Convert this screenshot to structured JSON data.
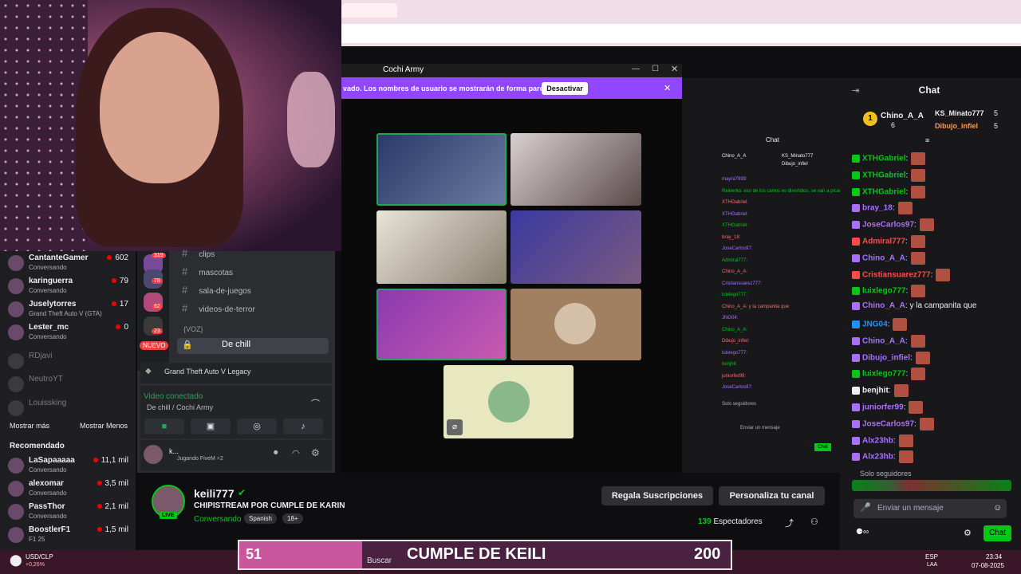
{
  "sidebar": {
    "followed": [
      {
        "name": "CantanteGamer",
        "status": "Conversando",
        "viewers": "602",
        "live": true
      },
      {
        "name": "karinguerra",
        "status": "Conversando",
        "viewers": "79",
        "live": true
      },
      {
        "name": "Juselytorres",
        "status": "Grand Theft Auto V (GTA)",
        "viewers": "17",
        "live": true
      },
      {
        "name": "Lester_mc",
        "status": "Conversando",
        "viewers": "0",
        "live": true
      },
      {
        "name": "RDjavi",
        "status": "",
        "viewers": "",
        "live": false
      },
      {
        "name": "NeutroYT",
        "status": "",
        "viewers": "",
        "live": false
      },
      {
        "name": "Louissking",
        "status": "",
        "viewers": "",
        "live": false
      }
    ],
    "show_more": "Mostrar más",
    "show_less": "Mostrar Menos",
    "recommended_title": "Recomendado",
    "recommended": [
      {
        "name": "LaSapaaaaa",
        "status": "Conversando",
        "viewers": "11,1 mil"
      },
      {
        "name": "alexomar",
        "status": "Conversando",
        "viewers": "3,5 mil"
      },
      {
        "name": "PassThor",
        "status": "Conversando",
        "viewers": "2,1 mil"
      },
      {
        "name": "BoostlerF1",
        "status": "F1 25",
        "viewers": "1,5 mil"
      }
    ]
  },
  "discord": {
    "server_badges": [
      "319",
      "78",
      "62",
      "23"
    ],
    "new_label": "NUEVO",
    "channels": [
      "clips",
      "mascotas",
      "sala-de-juegos",
      "videos-de-terror"
    ],
    "voice_group": "{VOZ}",
    "voice_channel": "De chill",
    "activity": "Grand Theft Auto V Legacy",
    "voice_connected": "Video conectado",
    "voice_sub": "De chill / Cochi Army",
    "username": "k...",
    "user_status": "Jugando FiveM +2"
  },
  "popup": {
    "title": "Cochi Army",
    "privacy_text": "vado. Los nombres de usuario se mostrarán de forma parcial.",
    "privacy_button": "Desactivar"
  },
  "mirror": {
    "chat_title": "Chat",
    "top_user1": "Chino_A_A",
    "top_user2": "KS_Minato777",
    "top_user3": "Dibujo_infiel",
    "lines": [
      "mayra7999:",
      "Reinerko: eso de los carros es divertidos, se van a picar",
      "XTHGabriel:",
      "XTHGabriel:",
      "XTHGabriel:",
      "bray_18:",
      "JoseCarlos97:",
      "Admiral777:",
      "Chino_A_A:",
      "Cristiansuarez777:",
      "luixlego777:",
      "Chino_A_A: y la campanita que",
      "JNG04:",
      "Chino_A_A:",
      "Dibujo_infiel:",
      "luixlego777:",
      "benjhit:",
      "juniorfer99:",
      "JoseCarlos97:"
    ],
    "followers_only": "Solo seguidores",
    "input_placeholder": "Enviar un mensaje",
    "send": "Chat"
  },
  "chat": {
    "title": "Chat",
    "leaders": [
      {
        "name": "Chino_A_A",
        "count": "6"
      },
      {
        "name": "KS_Minato777",
        "count": "5"
      },
      {
        "name": "Dibujo_infiel",
        "count": "5"
      }
    ],
    "messages": [
      {
        "user": "XTHGabriel",
        "text": "",
        "color": "#00c814"
      },
      {
        "user": "XTHGabriel",
        "text": "",
        "color": "#00c814"
      },
      {
        "user": "XTHGabriel",
        "text": "",
        "color": "#00c814"
      },
      {
        "user": "bray_18",
        "text": "",
        "color": "#a970ff"
      },
      {
        "user": "JoseCarlos97",
        "text": "",
        "color": "#a970ff"
      },
      {
        "user": "Admiral777",
        "text": "",
        "color": "#ff4a4a"
      },
      {
        "user": "Chino_A_A",
        "text": "",
        "color": "#a970ff"
      },
      {
        "user": "Cristiansuarez777",
        "text": "",
        "color": "#ff4a4a"
      },
      {
        "user": "luixlego777",
        "text": "",
        "color": "#00c814"
      },
      {
        "user": "Chino_A_A",
        "text": " y la campanita que",
        "color": "#a970ff"
      },
      {
        "user": "JNG04",
        "text": "",
        "color": "#1e90ff"
      },
      {
        "user": "Chino_A_A",
        "text": "",
        "color": "#a970ff"
      },
      {
        "user": "Dibujo_infiel",
        "text": "",
        "color": "#a970ff"
      },
      {
        "user": "luixlego777",
        "text": "",
        "color": "#00c814"
      },
      {
        "user": "benjhit",
        "text": "",
        "color": "#efeff1"
      },
      {
        "user": "juniorfer99",
        "text": "",
        "color": "#a970ff"
      },
      {
        "user": "JoseCarlos97",
        "text": "",
        "color": "#a970ff"
      },
      {
        "user": "Alx23hb",
        "text": "",
        "color": "#a970ff"
      },
      {
        "user": "Alx23hb",
        "text": "",
        "color": "#a970ff"
      }
    ],
    "followers_only": "Solo seguidores",
    "input_placeholder": "Enviar un mensaje",
    "send_label": "Chat"
  },
  "stream": {
    "streamer": "keili777",
    "live": "LIVE",
    "title": "CHIPISTREAM POR CUMPLE DE KARIN",
    "category": "Conversando",
    "tags": [
      "Spanish",
      "18+"
    ],
    "gift_button": "Regala Suscripciones",
    "customize_button": "Personaliza tu canal",
    "viewers_count": "139",
    "viewers_label": "Espectadores"
  },
  "banner": {
    "left_number": "51",
    "center_text": "CUMPLE DE KEILI",
    "right_number": "200"
  },
  "taskbar": {
    "search_placeholder": "Buscar",
    "fx_label": "USD/CLP",
    "fx_change": "+0,26%",
    "lang": "ESP",
    "lang_sub": "LAA",
    "time": "23:34",
    "date": "07-08-2025"
  },
  "colors": {
    "accent_green": "#00c814",
    "twitch_purple": "#9146ff",
    "discord_bg": "#2b2d31"
  }
}
